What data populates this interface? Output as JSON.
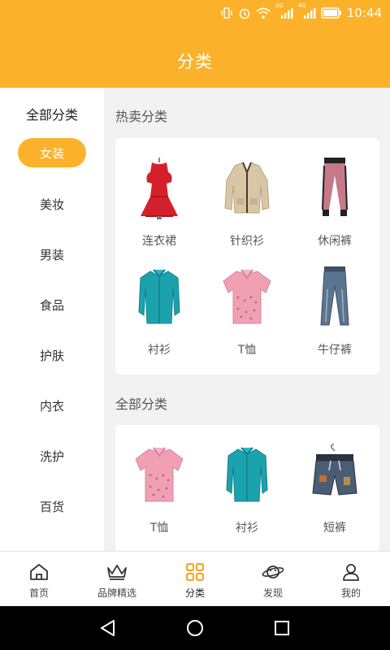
{
  "status": {
    "network_a": "2G",
    "network_b": "4G",
    "time": "10:44"
  },
  "colors": {
    "accent": "#fbb12a",
    "background": "#f2f2f2"
  },
  "title": "分类",
  "sidebar": {
    "heading": "全部分类",
    "items": [
      {
        "label": "女装",
        "active": true
      },
      {
        "label": "美妆"
      },
      {
        "label": "男装"
      },
      {
        "label": "食品"
      },
      {
        "label": "护肤"
      },
      {
        "label": "内衣"
      },
      {
        "label": "洗护"
      },
      {
        "label": "百货"
      }
    ]
  },
  "hot": {
    "title": "热卖分类",
    "items": [
      {
        "label": "连衣裙",
        "icon": "red-dress-icon"
      },
      {
        "label": "针织衫",
        "icon": "cardigan-icon"
      },
      {
        "label": "休闲裤",
        "icon": "casual-pants-icon"
      },
      {
        "label": "衬衫",
        "icon": "teal-shirt-icon"
      },
      {
        "label": "T恤",
        "icon": "pink-polo-icon"
      },
      {
        "label": "牛仔裤",
        "icon": "jeans-icon"
      }
    ]
  },
  "all": {
    "title": "全部分类",
    "items": [
      {
        "label": "T恤",
        "icon": "pink-polo-icon"
      },
      {
        "label": "衬衫",
        "icon": "teal-shirt-icon"
      },
      {
        "label": "短裤",
        "icon": "shorts-icon"
      }
    ]
  },
  "tabs": [
    {
      "label": "首页",
      "icon": "home-icon"
    },
    {
      "label": "品牌精选",
      "icon": "crown-icon"
    },
    {
      "label": "分类",
      "icon": "category-grid-icon",
      "active": true
    },
    {
      "label": "发现",
      "icon": "planet-icon"
    },
    {
      "label": "我的",
      "icon": "user-icon"
    }
  ]
}
